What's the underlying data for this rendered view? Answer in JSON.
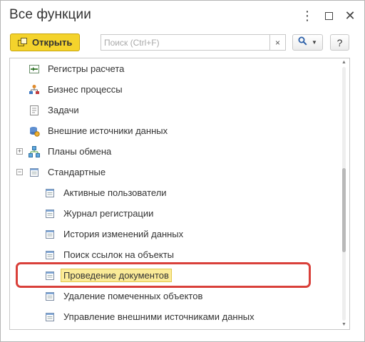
{
  "window": {
    "title": "Все функции",
    "menu_icon": "more-vertical-icon",
    "maximize_icon": "maximize-icon",
    "close_icon": "close-icon"
  },
  "toolbar": {
    "open_label": "Открыть",
    "open_icon": "open-icon",
    "search_placeholder": "Поиск (Ctrl+F)",
    "search_value": "",
    "clear_label": "×",
    "find_icon": "magnifier-icon",
    "help_label": "?"
  },
  "colors": {
    "accent_button": "#f4d32c",
    "selection": "#fbeb98",
    "annotation": "#d9403a"
  },
  "tree": {
    "items": [
      {
        "label": "Регистры расчета",
        "icon": "calc-register-icon",
        "level": 0,
        "expander": ""
      },
      {
        "label": "Бизнес процессы",
        "icon": "business-process-icon",
        "level": 0,
        "expander": ""
      },
      {
        "label": "Задачи",
        "icon": "task-icon",
        "level": 0,
        "expander": ""
      },
      {
        "label": "Внешние источники данных",
        "icon": "external-data-icon",
        "level": 0,
        "expander": ""
      },
      {
        "label": "Планы обмена",
        "icon": "exchange-plan-icon",
        "level": 0,
        "expander": "+"
      },
      {
        "label": "Стандартные",
        "icon": "standard-folder-icon",
        "level": 0,
        "expander": "−"
      },
      {
        "label": "Активные пользователи",
        "icon": "form-icon",
        "level": 1,
        "expander": ""
      },
      {
        "label": "Журнал регистрации",
        "icon": "form-icon",
        "level": 1,
        "expander": ""
      },
      {
        "label": "История изменений данных",
        "icon": "form-icon",
        "level": 1,
        "expander": ""
      },
      {
        "label": "Поиск ссылок на объекты",
        "icon": "form-icon",
        "level": 1,
        "expander": ""
      },
      {
        "label": "Проведение документов",
        "icon": "form-icon",
        "level": 1,
        "expander": "",
        "selected": true
      },
      {
        "label": "Удаление помеченных объектов",
        "icon": "form-icon",
        "level": 1,
        "expander": ""
      },
      {
        "label": "Управление внешними источниками данных",
        "icon": "form-icon",
        "level": 1,
        "expander": ""
      }
    ]
  }
}
